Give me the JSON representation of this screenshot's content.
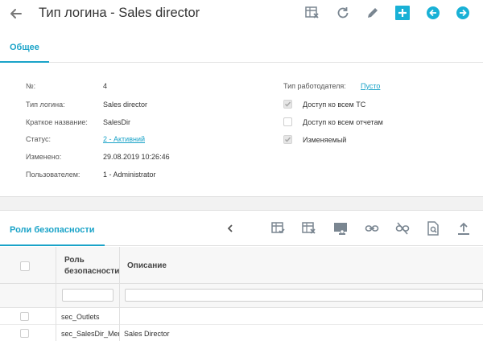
{
  "header": {
    "title": "Тип логина - Sales director"
  },
  "tabs": {
    "active": "Общее"
  },
  "form": {
    "left": [
      {
        "label": "№:",
        "value": "4"
      },
      {
        "label": "Тип логина:",
        "value": "Sales director"
      },
      {
        "label": "Краткое название:",
        "value": "SalesDir"
      },
      {
        "label": "Статус:",
        "value": "2 - Активний"
      },
      {
        "label": "Изменено:",
        "value": "29.08.2019 10:26:46"
      },
      {
        "label": "Пользователем:",
        "value": "1 - Administrator"
      }
    ],
    "employer_label": "Тип работодателя:",
    "employer_value": "Пусто",
    "checkboxes": [
      {
        "label": "Доступ ко всем ТС",
        "checked": true
      },
      {
        "label": "Доступ ко всем отчетам",
        "checked": false
      },
      {
        "label": "Изменяемый",
        "checked": true
      }
    ]
  },
  "lower": {
    "tab": "Роли безопасности"
  },
  "grid": {
    "col_role_line1": "Роль",
    "col_role_line2": "безопасности",
    "col_desc": "Описание",
    "rows": [
      {
        "role": "sec_Outlets",
        "desc": ""
      },
      {
        "role": "sec_SalesDir_Merc",
        "desc": "Sales Director"
      }
    ]
  },
  "colors": {
    "accent": "#1aa3c8",
    "nav_button": "#19b1d6"
  }
}
